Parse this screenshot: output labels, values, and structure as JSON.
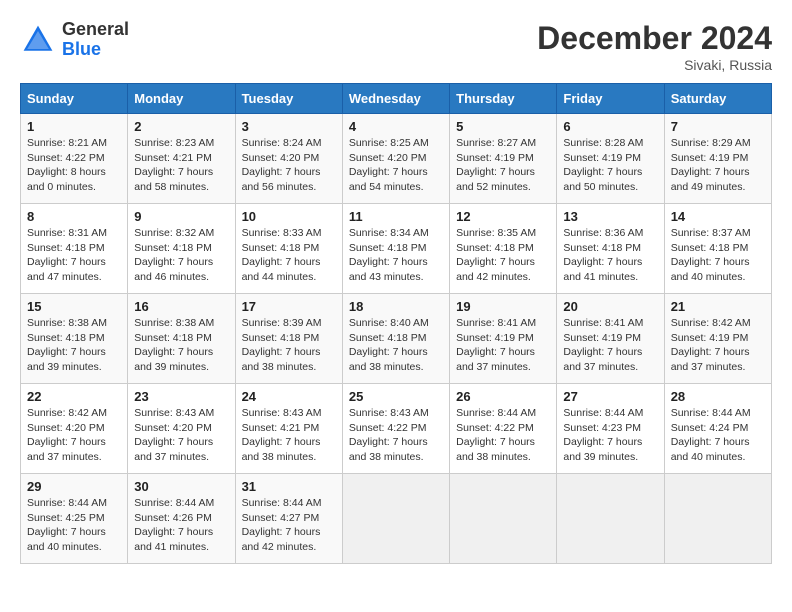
{
  "header": {
    "logo_line1": "General",
    "logo_line2": "Blue",
    "month": "December 2024",
    "location": "Sivaki, Russia"
  },
  "columns": [
    "Sunday",
    "Monday",
    "Tuesday",
    "Wednesday",
    "Thursday",
    "Friday",
    "Saturday"
  ],
  "weeks": [
    [
      {
        "day": "1",
        "info": "Sunrise: 8:21 AM\nSunset: 4:22 PM\nDaylight: 8 hours\nand 0 minutes."
      },
      {
        "day": "2",
        "info": "Sunrise: 8:23 AM\nSunset: 4:21 PM\nDaylight: 7 hours\nand 58 minutes."
      },
      {
        "day": "3",
        "info": "Sunrise: 8:24 AM\nSunset: 4:20 PM\nDaylight: 7 hours\nand 56 minutes."
      },
      {
        "day": "4",
        "info": "Sunrise: 8:25 AM\nSunset: 4:20 PM\nDaylight: 7 hours\nand 54 minutes."
      },
      {
        "day": "5",
        "info": "Sunrise: 8:27 AM\nSunset: 4:19 PM\nDaylight: 7 hours\nand 52 minutes."
      },
      {
        "day": "6",
        "info": "Sunrise: 8:28 AM\nSunset: 4:19 PM\nDaylight: 7 hours\nand 50 minutes."
      },
      {
        "day": "7",
        "info": "Sunrise: 8:29 AM\nSunset: 4:19 PM\nDaylight: 7 hours\nand 49 minutes."
      }
    ],
    [
      {
        "day": "8",
        "info": "Sunrise: 8:31 AM\nSunset: 4:18 PM\nDaylight: 7 hours\nand 47 minutes."
      },
      {
        "day": "9",
        "info": "Sunrise: 8:32 AM\nSunset: 4:18 PM\nDaylight: 7 hours\nand 46 minutes."
      },
      {
        "day": "10",
        "info": "Sunrise: 8:33 AM\nSunset: 4:18 PM\nDaylight: 7 hours\nand 44 minutes."
      },
      {
        "day": "11",
        "info": "Sunrise: 8:34 AM\nSunset: 4:18 PM\nDaylight: 7 hours\nand 43 minutes."
      },
      {
        "day": "12",
        "info": "Sunrise: 8:35 AM\nSunset: 4:18 PM\nDaylight: 7 hours\nand 42 minutes."
      },
      {
        "day": "13",
        "info": "Sunrise: 8:36 AM\nSunset: 4:18 PM\nDaylight: 7 hours\nand 41 minutes."
      },
      {
        "day": "14",
        "info": "Sunrise: 8:37 AM\nSunset: 4:18 PM\nDaylight: 7 hours\nand 40 minutes."
      }
    ],
    [
      {
        "day": "15",
        "info": "Sunrise: 8:38 AM\nSunset: 4:18 PM\nDaylight: 7 hours\nand 39 minutes."
      },
      {
        "day": "16",
        "info": "Sunrise: 8:38 AM\nSunset: 4:18 PM\nDaylight: 7 hours\nand 39 minutes."
      },
      {
        "day": "17",
        "info": "Sunrise: 8:39 AM\nSunset: 4:18 PM\nDaylight: 7 hours\nand 38 minutes."
      },
      {
        "day": "18",
        "info": "Sunrise: 8:40 AM\nSunset: 4:18 PM\nDaylight: 7 hours\nand 38 minutes."
      },
      {
        "day": "19",
        "info": "Sunrise: 8:41 AM\nSunset: 4:19 PM\nDaylight: 7 hours\nand 37 minutes."
      },
      {
        "day": "20",
        "info": "Sunrise: 8:41 AM\nSunset: 4:19 PM\nDaylight: 7 hours\nand 37 minutes."
      },
      {
        "day": "21",
        "info": "Sunrise: 8:42 AM\nSunset: 4:19 PM\nDaylight: 7 hours\nand 37 minutes."
      }
    ],
    [
      {
        "day": "22",
        "info": "Sunrise: 8:42 AM\nSunset: 4:20 PM\nDaylight: 7 hours\nand 37 minutes."
      },
      {
        "day": "23",
        "info": "Sunrise: 8:43 AM\nSunset: 4:20 PM\nDaylight: 7 hours\nand 37 minutes."
      },
      {
        "day": "24",
        "info": "Sunrise: 8:43 AM\nSunset: 4:21 PM\nDaylight: 7 hours\nand 38 minutes."
      },
      {
        "day": "25",
        "info": "Sunrise: 8:43 AM\nSunset: 4:22 PM\nDaylight: 7 hours\nand 38 minutes."
      },
      {
        "day": "26",
        "info": "Sunrise: 8:44 AM\nSunset: 4:22 PM\nDaylight: 7 hours\nand 38 minutes."
      },
      {
        "day": "27",
        "info": "Sunrise: 8:44 AM\nSunset: 4:23 PM\nDaylight: 7 hours\nand 39 minutes."
      },
      {
        "day": "28",
        "info": "Sunrise: 8:44 AM\nSunset: 4:24 PM\nDaylight: 7 hours\nand 40 minutes."
      }
    ],
    [
      {
        "day": "29",
        "info": "Sunrise: 8:44 AM\nSunset: 4:25 PM\nDaylight: 7 hours\nand 40 minutes."
      },
      {
        "day": "30",
        "info": "Sunrise: 8:44 AM\nSunset: 4:26 PM\nDaylight: 7 hours\nand 41 minutes."
      },
      {
        "day": "31",
        "info": "Sunrise: 8:44 AM\nSunset: 4:27 PM\nDaylight: 7 hours\nand 42 minutes."
      },
      {
        "day": "",
        "info": ""
      },
      {
        "day": "",
        "info": ""
      },
      {
        "day": "",
        "info": ""
      },
      {
        "day": "",
        "info": ""
      }
    ]
  ]
}
